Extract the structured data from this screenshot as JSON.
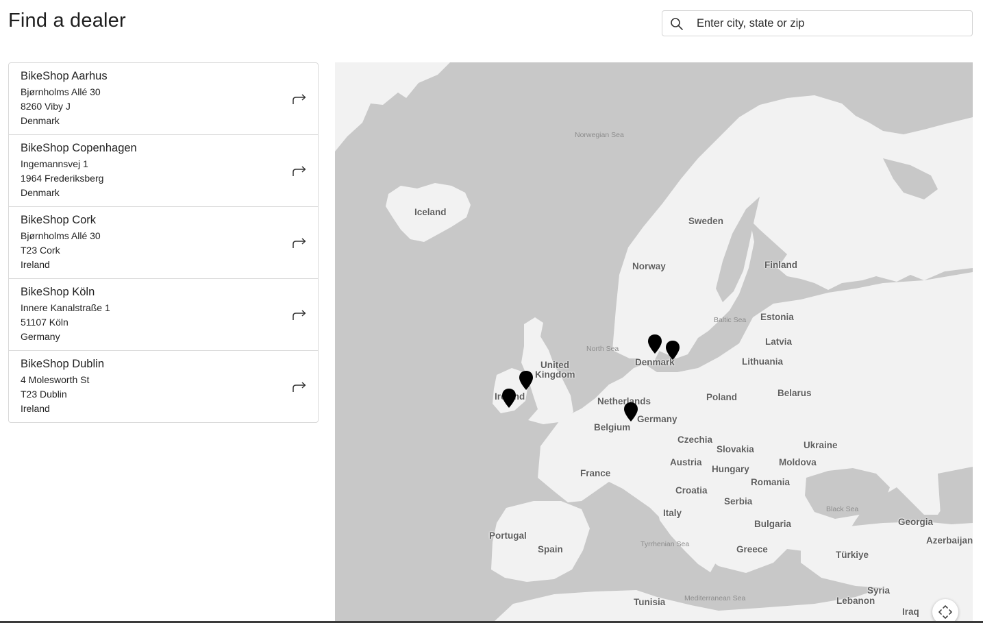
{
  "header": {
    "title": "Find a dealer"
  },
  "search": {
    "placeholder": "Enter city, state or zip",
    "icon": "search-icon"
  },
  "dealers": [
    {
      "name": "BikeShop Aarhus",
      "street": "Bjørnholms Allé 30",
      "city": "8260 Viby J",
      "country": "Denmark"
    },
    {
      "name": "BikeShop Copenhagen",
      "street": "Ingemannsvej 1",
      "city": "1964 Frederiksberg",
      "country": "Denmark"
    },
    {
      "name": "BikeShop Cork",
      "street": "Bjørnholms Allé 30",
      "city": "T23 Cork",
      "country": "Ireland"
    },
    {
      "name": "BikeShop Köln",
      "street": "Innere Kanalstraße 1",
      "city": "51107 Köln",
      "country": "Germany"
    },
    {
      "name": "BikeShop Dublin",
      "street": "4 Molesworth St",
      "city": "T23 Dublin",
      "country": "Ireland"
    }
  ],
  "map": {
    "countries": {
      "iceland": "Iceland",
      "sweden": "Sweden",
      "norway": "Norway",
      "finland": "Finland",
      "estonia": "Estonia",
      "latvia": "Latvia",
      "lithuania": "Lithuania",
      "denmark": "Denmark",
      "united_kingdom_1": "United",
      "united_kingdom_2": "Kingdom",
      "ireland": "Ireland",
      "netherlands": "Netherlands",
      "poland": "Poland",
      "belarus": "Belarus",
      "germany": "Germany",
      "belgium": "Belgium",
      "czechia": "Czechia",
      "slovakia": "Slovakia",
      "ukraine": "Ukraine",
      "austria": "Austria",
      "moldova": "Moldova",
      "hungary": "Hungary",
      "france": "France",
      "romania": "Romania",
      "croatia": "Croatia",
      "serbia": "Serbia",
      "italy": "Italy",
      "bulgaria": "Bulgaria",
      "georgia": "Georgia",
      "portugal": "Portugal",
      "spain": "Spain",
      "greece": "Greece",
      "azerbaijan": "Azerbaijan",
      "turkiye": "Türkiye",
      "syria": "Syria",
      "tunisia": "Tunisia",
      "lebanon": "Lebanon",
      "iraq": "Iraq"
    },
    "seas": {
      "norwegian_sea": "Norwegian Sea",
      "north_sea": "North Sea",
      "baltic_sea": "Baltic Sea",
      "black_sea": "Black Sea",
      "tyrrhenian_sea": "Tyrrhenian Sea",
      "mediterranean_sea": "Mediterranean Sea"
    },
    "colors": {
      "land": "#f2f2f2",
      "water": "#c8c8c8",
      "marker": "#000000"
    },
    "markers": [
      "Aarhus",
      "Copenhagen",
      "Dublin",
      "Cork",
      "Köln"
    ]
  }
}
